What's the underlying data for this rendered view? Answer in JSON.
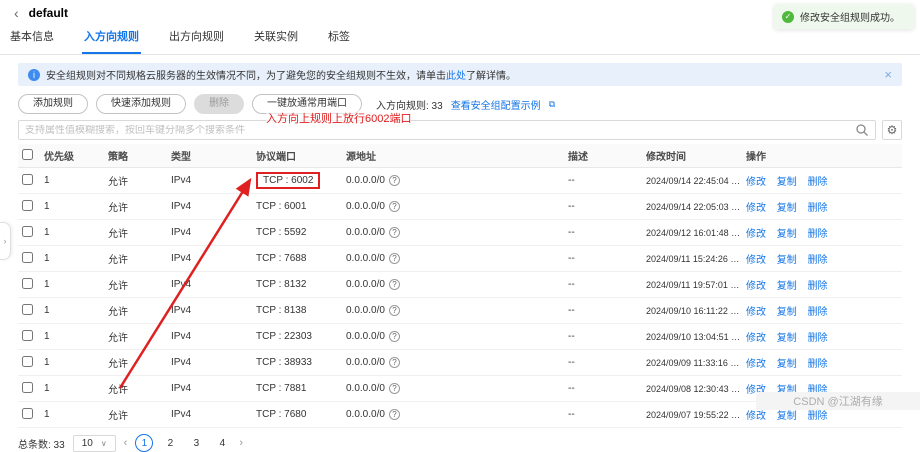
{
  "colors": {
    "accent_blue": "#1476e8",
    "annotation_red": "#e02020",
    "toast_green": "#50b83c",
    "banner_bg": "#e8f1fb"
  },
  "icons": {
    "back": "‹",
    "info": "i",
    "close": "×",
    "help": "?",
    "gear": "⚙",
    "external": "⧉",
    "check": "✓",
    "chevron_down": "∨",
    "prev": "‹",
    "next": "›",
    "expander": "›"
  },
  "header": {
    "title": "default"
  },
  "toast": {
    "message": "修改安全组规则成功。"
  },
  "tabs": [
    {
      "label": "基本信息"
    },
    {
      "label": "入方向规则"
    },
    {
      "label": "出方向规则"
    },
    {
      "label": "关联实例"
    },
    {
      "label": "标签"
    }
  ],
  "banner": {
    "text_before": "安全组规则对不同规格云服务器的生效情况不同，为了避免您的安全组规则不生效，请单击",
    "link_text": "此处",
    "text_after": "了解详情。"
  },
  "toolbar": {
    "add_rule": "添加规则",
    "quick_add_rule": "快速添加规则",
    "delete": "删除",
    "open_common_ports": "一键放通常用端口",
    "rule_count_label": "入方向规则: 33",
    "config_example_link": "查看安全组配置示例"
  },
  "search": {
    "placeholder": "支持属性值模糊搜索，按回车键分隔多个搜索条件"
  },
  "annotation": {
    "note": "入方向上规则上放行6002端口"
  },
  "table": {
    "columns": [
      "优先级",
      "策略",
      "类型",
      "协议端口",
      "源地址",
      "描述",
      "修改时间",
      "操作"
    ],
    "actions": [
      "修改",
      "复制",
      "删除"
    ],
    "rows": [
      {
        "priority": "1",
        "policy": "允许",
        "type": "IPv4",
        "port": "TCP : 6002",
        "source": "0.0.0.0/0",
        "desc": "--",
        "time": "2024/09/14 22:45:04 …",
        "highlighted": true
      },
      {
        "priority": "1",
        "policy": "允许",
        "type": "IPv4",
        "port": "TCP : 6001",
        "source": "0.0.0.0/0",
        "desc": "--",
        "time": "2024/09/14 22:05:03 …",
        "highlighted": false
      },
      {
        "priority": "1",
        "policy": "允许",
        "type": "IPv4",
        "port": "TCP : 5592",
        "source": "0.0.0.0/0",
        "desc": "--",
        "time": "2024/09/12 16:01:48 …",
        "highlighted": false
      },
      {
        "priority": "1",
        "policy": "允许",
        "type": "IPv4",
        "port": "TCP : 7688",
        "source": "0.0.0.0/0",
        "desc": "--",
        "time": "2024/09/11 15:24:26 …",
        "highlighted": false
      },
      {
        "priority": "1",
        "policy": "允许",
        "type": "IPv4",
        "port": "TCP : 8132",
        "source": "0.0.0.0/0",
        "desc": "--",
        "time": "2024/09/11 19:57:01 …",
        "highlighted": false
      },
      {
        "priority": "1",
        "policy": "允许",
        "type": "IPv4",
        "port": "TCP : 8138",
        "source": "0.0.0.0/0",
        "desc": "--",
        "time": "2024/09/10 16:11:22 …",
        "highlighted": false
      },
      {
        "priority": "1",
        "policy": "允许",
        "type": "IPv4",
        "port": "TCP : 22303",
        "source": "0.0.0.0/0",
        "desc": "--",
        "time": "2024/09/10 13:04:51 …",
        "highlighted": false
      },
      {
        "priority": "1",
        "policy": "允许",
        "type": "IPv4",
        "port": "TCP : 38933",
        "source": "0.0.0.0/0",
        "desc": "--",
        "time": "2024/09/09 11:33:16 …",
        "highlighted": false
      },
      {
        "priority": "1",
        "policy": "允许",
        "type": "IPv4",
        "port": "TCP : 7881",
        "source": "0.0.0.0/0",
        "desc": "--",
        "time": "2024/09/08 12:30:43 …",
        "highlighted": false
      },
      {
        "priority": "1",
        "policy": "允许",
        "type": "IPv4",
        "port": "TCP : 7680",
        "source": "0.0.0.0/0",
        "desc": "--",
        "time": "2024/09/07 19:55:22 …",
        "highlighted": false
      }
    ]
  },
  "pagination": {
    "total_label": "总条数: 33",
    "page_size": "10",
    "pages": [
      "1",
      "2",
      "3",
      "4"
    ]
  },
  "watermark": "CSDN @江湖有缘"
}
